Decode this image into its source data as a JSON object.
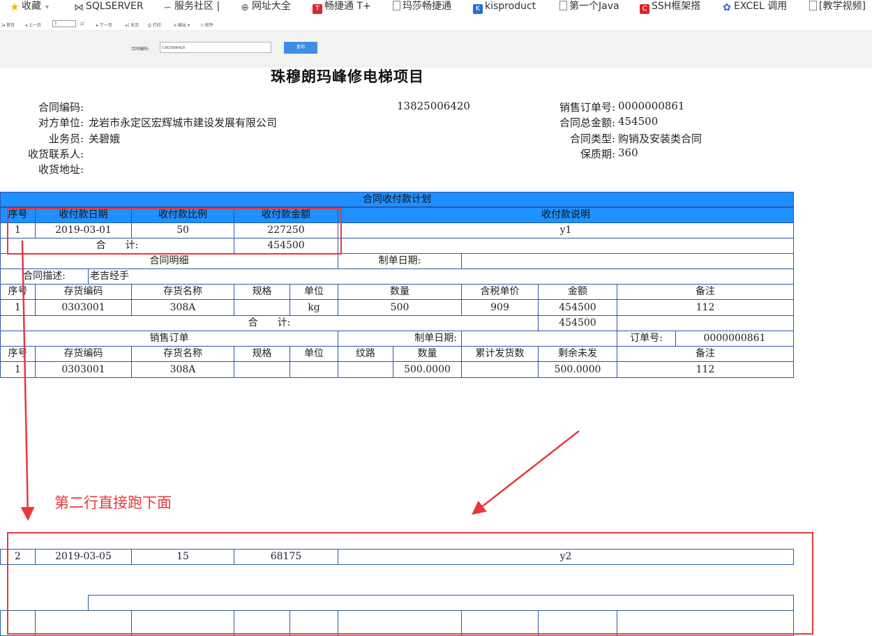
{
  "bookmarks": [
    {
      "label": "收藏",
      "icon": "star-icon"
    },
    {
      "label": "SQLSERVER",
      "icon": "vs-icon"
    },
    {
      "label": "服务社区 |",
      "icon": "swirl-icon"
    },
    {
      "label": "网址大全",
      "icon": "globe-icon"
    },
    {
      "label": "畅捷通 T+",
      "icon": "tplus-icon"
    },
    {
      "label": "玛莎畅捷通",
      "icon": "page-icon"
    },
    {
      "label": "kisproduct",
      "icon": "kis-icon"
    },
    {
      "label": "第一个Java",
      "icon": "page-icon"
    },
    {
      "label": "SSH框架搭",
      "icon": "c-icon"
    },
    {
      "label": "EXCEL 调用",
      "icon": "paw-icon"
    },
    {
      "label": "[教学视频]",
      "icon": "page-icon"
    }
  ],
  "toolbar": {
    "first": "首页",
    "prev": "上一页",
    "page": "1",
    "total": "/2",
    "next": "下一页",
    "last": "末页",
    "print": "打印",
    "export": "输出",
    "mail": "邮件"
  },
  "search": {
    "label": "合同编码:",
    "value": "13825006420",
    "button": "查询"
  },
  "report": {
    "title": "珠穆朗玛峰修电梯项目",
    "contract_code_label": "合同编码:",
    "contract_code": "13825006420",
    "party_label": "对方单位:",
    "party": "龙岩市永定区宏辉城市建设发展有限公司",
    "salesman_label": "业务员:",
    "salesman": "关碧娥",
    "consignee_label": "收货联系人:",
    "address_label": "收货地址:",
    "order_no_label": "销售订单号:",
    "order_no": "0000000861",
    "total_label": "合同总金额:",
    "total": "454500",
    "type_label": "合同类型:",
    "type": "购销及安装类合同",
    "warranty_label": "保质期:",
    "warranty": "360"
  },
  "plan": {
    "title": "合同收付款计划",
    "headers": [
      "序号",
      "收付款日期",
      "收付款比例",
      "收付款金额",
      "收付款说明"
    ],
    "rows": [
      [
        "1",
        "2019-03-01",
        "50",
        "227250",
        "y1"
      ],
      [
        "2",
        "2019-03-05",
        "15",
        "68175",
        "y2"
      ]
    ],
    "total_label": "合　　计:",
    "total": "454500"
  },
  "detail": {
    "title": "合同明细",
    "date_label": "制单日期:",
    "desc_label": "合同描述:",
    "desc": "老吉经手",
    "headers": [
      "序号",
      "存货编码",
      "存货名称",
      "规格",
      "单位",
      "数量",
      "含税单价",
      "金额",
      "备注"
    ],
    "row": [
      "1",
      "0303001",
      "308A",
      "",
      "kg",
      "500",
      "909",
      "454500",
      "112"
    ],
    "total_label": "合　　计:",
    "total": "454500"
  },
  "sales": {
    "title": "销售订单",
    "date_label": "制单日期:",
    "order_label": "订单号:",
    "order_no": "0000000861",
    "headers": [
      "序号",
      "存货编码",
      "存货名称",
      "规格",
      "单位",
      "纹路",
      "数量",
      "累计发货数",
      "剩余未发",
      "备注"
    ],
    "row": [
      "1",
      "0303001",
      "308A",
      "",
      "",
      "",
      "500.0000",
      "",
      "500.0000",
      "112"
    ]
  },
  "annotation": {
    "text": "第二行直接跑下面",
    "color": "#e8383d"
  }
}
